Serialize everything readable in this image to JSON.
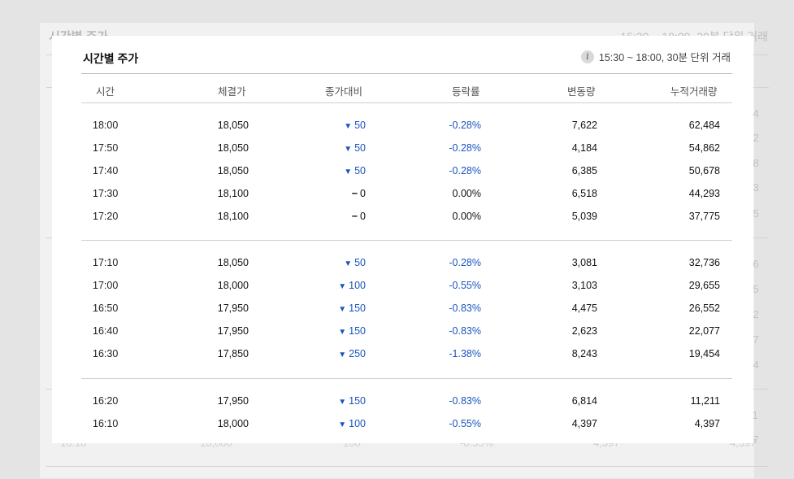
{
  "background": {
    "title": "시간별 주가",
    "info": "15:30 ~ 18:00, 30분 단위 거래",
    "header_fragment": "량",
    "right_column_fragments": [
      "484",
      "862",
      "678",
      "293",
      "775",
      "736",
      "655",
      "552",
      "077",
      "454",
      "211",
      "397"
    ],
    "bottom_row": [
      "16:10",
      "18,000",
      "100",
      "-0.55%",
      "4,397",
      "4,397"
    ]
  },
  "popup": {
    "title": "시간별 주가",
    "info_icon": "info-icon",
    "info_text": "15:30 ~ 18:00, 30분 단위 거래",
    "columns": [
      "시간",
      "체결가",
      "종가대비",
      "등락률",
      "변동량",
      "누적거래량"
    ],
    "groups": [
      {
        "rows": [
          {
            "time": "18:00",
            "price": "18,050",
            "dir": "down",
            "change": "50",
            "rate": "-0.28%",
            "vol": "7,622",
            "cum": "62,484"
          },
          {
            "time": "17:50",
            "price": "18,050",
            "dir": "down",
            "change": "50",
            "rate": "-0.28%",
            "vol": "4,184",
            "cum": "54,862"
          },
          {
            "time": "17:40",
            "price": "18,050",
            "dir": "down",
            "change": "50",
            "rate": "-0.28%",
            "vol": "6,385",
            "cum": "50,678"
          },
          {
            "time": "17:30",
            "price": "18,100",
            "dir": "flat",
            "change": "0",
            "rate": "0.00%",
            "vol": "6,518",
            "cum": "44,293"
          },
          {
            "time": "17:20",
            "price": "18,100",
            "dir": "flat",
            "change": "0",
            "rate": "0.00%",
            "vol": "5,039",
            "cum": "37,775"
          }
        ]
      },
      {
        "rows": [
          {
            "time": "17:10",
            "price": "18,050",
            "dir": "down",
            "change": "50",
            "rate": "-0.28%",
            "vol": "3,081",
            "cum": "32,736"
          },
          {
            "time": "17:00",
            "price": "18,000",
            "dir": "down",
            "change": "100",
            "rate": "-0.55%",
            "vol": "3,103",
            "cum": "29,655"
          },
          {
            "time": "16:50",
            "price": "17,950",
            "dir": "down",
            "change": "150",
            "rate": "-0.83%",
            "vol": "4,475",
            "cum": "26,552"
          },
          {
            "time": "16:40",
            "price": "17,950",
            "dir": "down",
            "change": "150",
            "rate": "-0.83%",
            "vol": "2,623",
            "cum": "22,077"
          },
          {
            "time": "16:30",
            "price": "17,850",
            "dir": "down",
            "change": "250",
            "rate": "-1.38%",
            "vol": "8,243",
            "cum": "19,454"
          }
        ]
      },
      {
        "rows": [
          {
            "time": "16:20",
            "price": "17,950",
            "dir": "down",
            "change": "150",
            "rate": "-0.83%",
            "vol": "6,814",
            "cum": "11,211"
          },
          {
            "time": "16:10",
            "price": "18,000",
            "dir": "down",
            "change": "100",
            "rate": "-0.55%",
            "vol": "4,397",
            "cum": "4,397"
          }
        ]
      }
    ],
    "colors": {
      "down": "#1a55c0",
      "flat": "#111111"
    },
    "symbols": {
      "down": "▼",
      "flat": "−"
    }
  }
}
